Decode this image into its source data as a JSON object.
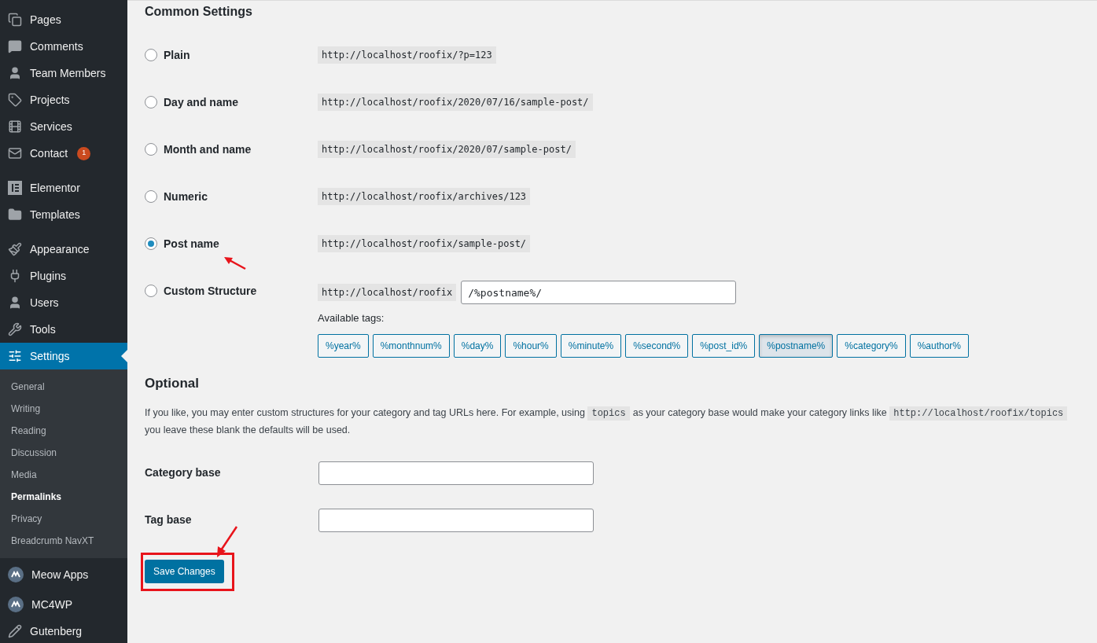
{
  "sidebar": {
    "items": [
      {
        "label": "Pages",
        "selected": false
      },
      {
        "label": "Comments",
        "selected": false
      },
      {
        "label": "Team Members",
        "selected": false
      },
      {
        "label": "Projects",
        "selected": false
      },
      {
        "label": "Services",
        "selected": false
      },
      {
        "label": "Contact",
        "selected": false,
        "badge": "1"
      },
      {
        "label": "Elementor",
        "selected": false
      },
      {
        "label": "Templates",
        "selected": false
      },
      {
        "label": "Appearance",
        "selected": false
      },
      {
        "label": "Plugins",
        "selected": false
      },
      {
        "label": "Users",
        "selected": false
      },
      {
        "label": "Tools",
        "selected": false
      },
      {
        "label": "Settings",
        "selected": true,
        "children": [
          {
            "label": "General",
            "selected": false
          },
          {
            "label": "Writing",
            "selected": false
          },
          {
            "label": "Reading",
            "selected": false
          },
          {
            "label": "Discussion",
            "selected": false
          },
          {
            "label": "Media",
            "selected": false
          },
          {
            "label": "Permalinks",
            "selected": true
          },
          {
            "label": "Privacy",
            "selected": false
          },
          {
            "label": "Breadcrumb NavXT",
            "selected": false
          }
        ]
      },
      {
        "label": "Meow Apps",
        "selected": false
      },
      {
        "label": "MC4WP",
        "selected": false
      },
      {
        "label": "Gutenberg",
        "selected": false
      }
    ]
  },
  "common_settings": {
    "title": "Common Settings",
    "options": [
      {
        "label": "Plain",
        "kind": "example",
        "example": "http://localhost/roofix/?p=123",
        "selected": false
      },
      {
        "label": "Day and name",
        "kind": "example",
        "example": "http://localhost/roofix/2020/07/16/sample-post/",
        "selected": false
      },
      {
        "label": "Month and name",
        "kind": "example",
        "example": "http://localhost/roofix/2020/07/sample-post/",
        "selected": false
      },
      {
        "label": "Numeric",
        "kind": "example",
        "example": "http://localhost/roofix/archives/123",
        "selected": false
      },
      {
        "label": "Post name",
        "kind": "example",
        "example": "http://localhost/roofix/sample-post/",
        "selected": true,
        "annotated": true
      },
      {
        "label": "Custom Structure",
        "kind": "custom",
        "example": "http://localhost/roofix",
        "value": "/%postname%/",
        "selected": false
      }
    ],
    "tags_label": "Available tags:",
    "tags": [
      {
        "label": "%year%",
        "selected": false
      },
      {
        "label": "%monthnum%",
        "selected": false
      },
      {
        "label": "%day%",
        "selected": false
      },
      {
        "label": "%hour%",
        "selected": false
      },
      {
        "label": "%minute%",
        "selected": false
      },
      {
        "label": "%second%",
        "selected": false
      },
      {
        "label": "%post_id%",
        "selected": false
      },
      {
        "label": "%postname%",
        "selected": true
      },
      {
        "label": "%category%",
        "selected": false
      },
      {
        "label": "%author%",
        "selected": false
      }
    ]
  },
  "optional": {
    "title": "Optional",
    "description": [
      {
        "kind": "text",
        "text": "If you like, you may enter custom structures for your category and tag URLs here. For example, using"
      },
      {
        "kind": "code",
        "text": "topics"
      },
      {
        "kind": "text",
        "text": "as your category base would make your category links like"
      },
      {
        "kind": "code",
        "text": "http://localhost/roofix/topics"
      },
      {
        "kind": "break",
        "text": "you leave these blank the defaults will be used."
      }
    ],
    "fields": [
      {
        "label": "Category base"
      },
      {
        "label": "Tag base"
      }
    ]
  },
  "save_button": {
    "label": "Save Changes",
    "annotated": true
  }
}
